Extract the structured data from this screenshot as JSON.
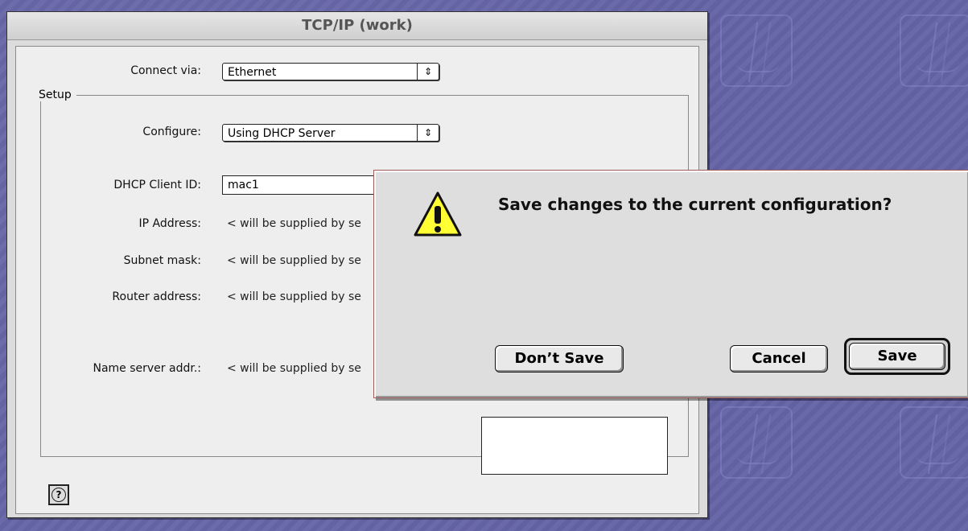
{
  "window": {
    "title": "TCP/IP (work)"
  },
  "form": {
    "connect_via_label": "Connect via:",
    "connect_via_value": "Ethernet",
    "setup_group_label": "Setup",
    "configure_label": "Configure:",
    "configure_value": "Using DHCP Server",
    "dhcp_client_id_label": "DHCP Client ID:",
    "dhcp_client_id_value": "mac1",
    "ip_address_label": "IP Address:",
    "ip_address_value": "< will be supplied by se",
    "subnet_mask_label": "Subnet mask:",
    "subnet_mask_value": "< will be supplied by se",
    "router_address_label": "Router address:",
    "router_address_value": "< will be supplied by se",
    "name_server_label": "Name server addr.:",
    "name_server_value": "< will be supplied by se",
    "help_glyph": "?"
  },
  "dialog": {
    "message": "Save changes to the current configuration?",
    "dont_save_label": "Don’t Save",
    "cancel_label": "Cancel",
    "save_label": "Save"
  },
  "icons": {
    "popup_arrow": "updown-arrows-icon",
    "warning": "warning-triangle-icon"
  }
}
